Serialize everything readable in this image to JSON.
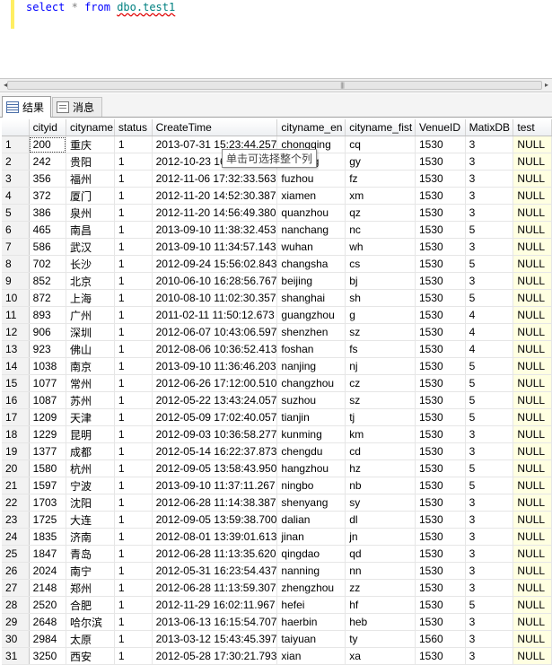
{
  "editor": {
    "kw_select": "select",
    "star": "*",
    "kw_from": "from",
    "object": "dbo.test1"
  },
  "tabs": [
    {
      "label": "结果",
      "icon": "results-grid-icon"
    },
    {
      "label": "消息",
      "icon": "messages-icon"
    }
  ],
  "tooltip": "单击可选择整个列",
  "columns": [
    "",
    "cityid",
    "cityname",
    "status",
    "CreateTime",
    "cityname_en",
    "cityname_fist",
    "VenueID",
    "MatixDB",
    "test"
  ],
  "rows": [
    [
      "1",
      "200",
      "重庆",
      "1",
      "2013-07-31 15:23:44.257",
      "chongqing",
      "cq",
      "1530",
      "3",
      "NULL"
    ],
    [
      "2",
      "242",
      "贵阳",
      "1",
      "2012-10-23 16:50:24.000",
      "guiyang",
      "gy",
      "1530",
      "3",
      "NULL"
    ],
    [
      "3",
      "356",
      "福州",
      "1",
      "2012-11-06 17:32:33.563",
      "fuzhou",
      "fz",
      "1530",
      "3",
      "NULL"
    ],
    [
      "4",
      "372",
      "厦门",
      "1",
      "2012-11-20 14:52:30.387",
      "xiamen",
      "xm",
      "1530",
      "3",
      "NULL"
    ],
    [
      "5",
      "386",
      "泉州",
      "1",
      "2012-11-20 14:56:49.380",
      "quanzhou",
      "qz",
      "1530",
      "3",
      "NULL"
    ],
    [
      "6",
      "465",
      "南昌",
      "1",
      "2013-09-10 11:38:32.453",
      "nanchang",
      "nc",
      "1530",
      "5",
      "NULL"
    ],
    [
      "7",
      "586",
      "武汉",
      "1",
      "2013-09-10 11:34:57.143",
      "wuhan",
      "wh",
      "1530",
      "3",
      "NULL"
    ],
    [
      "8",
      "702",
      "长沙",
      "1",
      "2012-09-24 15:56:02.843",
      "changsha",
      "cs",
      "1530",
      "5",
      "NULL"
    ],
    [
      "9",
      "852",
      "北京",
      "1",
      "2010-06-10 16:28:56.767",
      "beijing",
      "bj",
      "1530",
      "3",
      "NULL"
    ],
    [
      "10",
      "872",
      "上海",
      "1",
      "2010-08-10 11:02:30.357",
      "shanghai",
      "sh",
      "1530",
      "5",
      "NULL"
    ],
    [
      "11",
      "893",
      "广州",
      "1",
      "2011-02-11 11:50:12.673",
      "guangzhou",
      "g",
      "1530",
      "4",
      "NULL"
    ],
    [
      "12",
      "906",
      "深圳",
      "1",
      "2012-06-07 10:43:06.597",
      "shenzhen",
      "sz",
      "1530",
      "4",
      "NULL"
    ],
    [
      "13",
      "923",
      "佛山",
      "1",
      "2012-08-06 10:36:52.413",
      "foshan",
      "fs",
      "1530",
      "4",
      "NULL"
    ],
    [
      "14",
      "1038",
      "南京",
      "1",
      "2013-09-10 11:36:46.203",
      "nanjing",
      "nj",
      "1530",
      "5",
      "NULL"
    ],
    [
      "15",
      "1077",
      "常州",
      "1",
      "2012-06-26 17:12:00.510",
      "changzhou",
      "cz",
      "1530",
      "5",
      "NULL"
    ],
    [
      "16",
      "1087",
      "苏州",
      "1",
      "2012-05-22 13:43:24.057",
      "suzhou",
      "sz",
      "1530",
      "5",
      "NULL"
    ],
    [
      "17",
      "1209",
      "天津",
      "1",
      "2012-05-09 17:02:40.057",
      "tianjin",
      "tj",
      "1530",
      "5",
      "NULL"
    ],
    [
      "18",
      "1229",
      "昆明",
      "1",
      "2012-09-03 10:36:58.277",
      "kunming",
      "km",
      "1530",
      "3",
      "NULL"
    ],
    [
      "19",
      "1377",
      "成都",
      "1",
      "2012-05-14 16:22:37.873",
      "chengdu",
      "cd",
      "1530",
      "3",
      "NULL"
    ],
    [
      "20",
      "1580",
      "杭州",
      "1",
      "2012-09-05 13:58:43.950",
      "hangzhou",
      "hz",
      "1530",
      "5",
      "NULL"
    ],
    [
      "21",
      "1597",
      "宁波",
      "1",
      "2013-09-10 11:37:11.267",
      "ningbo",
      "nb",
      "1530",
      "5",
      "NULL"
    ],
    [
      "22",
      "1703",
      "沈阳",
      "1",
      "2012-06-28 11:14:38.387",
      "shenyang",
      "sy",
      "1530",
      "3",
      "NULL"
    ],
    [
      "23",
      "1725",
      "大连",
      "1",
      "2012-09-05 13:59:38.700",
      "dalian",
      "dl",
      "1530",
      "3",
      "NULL"
    ],
    [
      "24",
      "1835",
      "济南",
      "1",
      "2012-08-01 13:39:01.613",
      "jinan",
      "jn",
      "1530",
      "3",
      "NULL"
    ],
    [
      "25",
      "1847",
      "青岛",
      "1",
      "2012-06-28 11:13:35.620",
      "qingdao",
      "qd",
      "1530",
      "3",
      "NULL"
    ],
    [
      "26",
      "2024",
      "南宁",
      "1",
      "2012-05-31 16:23:54.437",
      "nanning",
      "nn",
      "1530",
      "3",
      "NULL"
    ],
    [
      "27",
      "2148",
      "郑州",
      "1",
      "2012-06-28 11:13:59.307",
      "zhengzhou",
      "zz",
      "1530",
      "3",
      "NULL"
    ],
    [
      "28",
      "2520",
      "合肥",
      "1",
      "2012-11-29 16:02:11.967",
      "hefei",
      "hf",
      "1530",
      "5",
      "NULL"
    ],
    [
      "29",
      "2648",
      "哈尔滨",
      "1",
      "2013-06-13 16:15:54.707",
      "haerbin",
      "heb",
      "1530",
      "3",
      "NULL"
    ],
    [
      "30",
      "2984",
      "太原",
      "1",
      "2013-03-12 15:43:45.397",
      "taiyuan",
      "ty",
      "1560",
      "3",
      "NULL"
    ],
    [
      "31",
      "3250",
      "西安",
      "1",
      "2012-05-28 17:30:21.793",
      "xian",
      "xa",
      "1530",
      "3",
      "NULL"
    ]
  ]
}
